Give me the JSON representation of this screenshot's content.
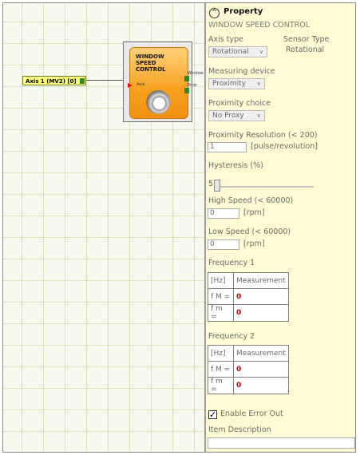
{
  "canvas": {
    "axis_input": {
      "label": "Axis 1 (MV2) [0]"
    },
    "block": {
      "title_lines": [
        "WINDOW",
        "SPEED",
        "CONTROL"
      ],
      "input_label": "Axis",
      "output_window": "Window",
      "output_error": "Error"
    }
  },
  "property": {
    "header": "Property",
    "subtitle": "WINDOW SPEED CONTROL",
    "axis_type_label": "Axis type",
    "axis_type_value": "Rotational",
    "sensor_type_label": "Sensor Type",
    "sensor_type_value": "Rotational",
    "measuring_device_label": "Measuring device",
    "measuring_device_value": "Proximity",
    "proximity_choice_label": "Proximity choice",
    "proximity_choice_value": "No Proxy",
    "proximity_resolution_label": "Proximity Resolution  (< 200)",
    "proximity_resolution_value": "1",
    "proximity_resolution_unit": "[pulse/revolution]",
    "hysteresis_label": "Hysteresis (%)",
    "hysteresis_value": "5",
    "high_speed_label": "High Speed  (< 60000)",
    "high_speed_value": "0",
    "high_speed_unit": "[rpm]",
    "low_speed_label": "Low Speed  (< 60000)",
    "low_speed_value": "0",
    "low_speed_unit": "[rpm]",
    "frequency1": {
      "label": "Frequency 1",
      "header": [
        "[Hz]",
        "Measurement"
      ],
      "rows": [
        {
          "name": "f M =",
          "value": "0"
        },
        {
          "name": "f m =",
          "value": "0"
        }
      ]
    },
    "frequency2": {
      "label": "Frequency 2",
      "header": [
        "[Hz]",
        "Measurement"
      ],
      "rows": [
        {
          "name": "f M =",
          "value": "0"
        },
        {
          "name": "f m =",
          "value": "0"
        }
      ]
    },
    "enable_error_out_label": "Enable Error Out",
    "enable_error_out_checked": true,
    "item_description_label": "Item Description",
    "item_description_value": ""
  },
  "icons": {
    "collapse": "chevron-up-icon",
    "dropdown": "chevron-down-icon",
    "check": "checkmark-icon"
  },
  "colors": {
    "panel_bg": "#fffbd4",
    "canvas_bg": "#f7f9ef",
    "grid": "#d7e3bd",
    "axis_input_bg": "#ffff7a",
    "block_fill": "#f7a11f",
    "port": "#2f8a2f",
    "value_red": "#d00000"
  }
}
